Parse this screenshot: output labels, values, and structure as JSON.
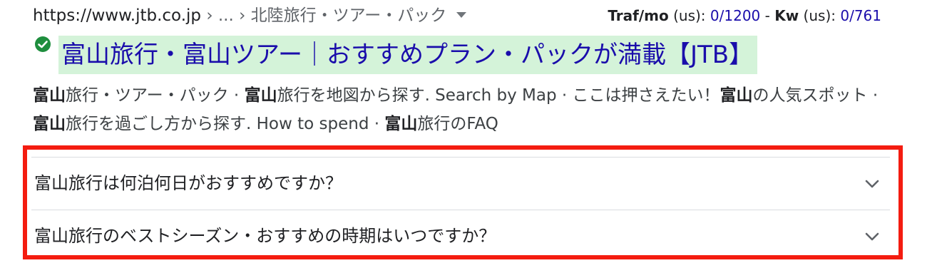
{
  "result": {
    "url_domain": "https://www.jtb.co.jp",
    "breadcrumb_sep1": " › ",
    "breadcrumb_ellipsis": "...",
    "breadcrumb_sep2": " › ",
    "breadcrumb_path": "北陸旅行・ツアー・パック",
    "metrics": {
      "traf_label": "Traf/mo",
      "traf_region": " (us): ",
      "traf_value": "0/1200",
      "dash": " - ",
      "kw_label": "Kw",
      "kw_region": " (us): ",
      "kw_value": "0/761"
    },
    "title": "富山旅行・富山ツアー｜おすすめプラン・パックが満載【JTB】",
    "snippet": {
      "s1_bold": "富山",
      "s1": "旅行・ツアー・パック · ",
      "s2_bold": "富山",
      "s2": "旅行を地図から探す. Search by Map · ここは押さえたい！",
      "s3_bold": "富山",
      "s3": "の人気スポット · ",
      "s4_bold": "富山",
      "s4": "旅行を過ごし方から探す. How to spend · ",
      "s5_bold": "富山",
      "s5": "旅行のFAQ"
    },
    "faq": [
      {
        "question": "富山旅行は何泊何日がおすすめですか？"
      },
      {
        "question": "富山旅行のベストシーズン・おすすめの時期はいつですか？"
      }
    ]
  },
  "colors": {
    "link": "#1a0dab",
    "title_highlight": "#d4f3d9",
    "annotation_box": "#f41c10",
    "verified_check": "#1e8e3e"
  },
  "icons": {
    "verified": "check-circle-icon",
    "breadcrumb_menu": "caret-down-icon",
    "faq_expand": "chevron-down-icon"
  }
}
